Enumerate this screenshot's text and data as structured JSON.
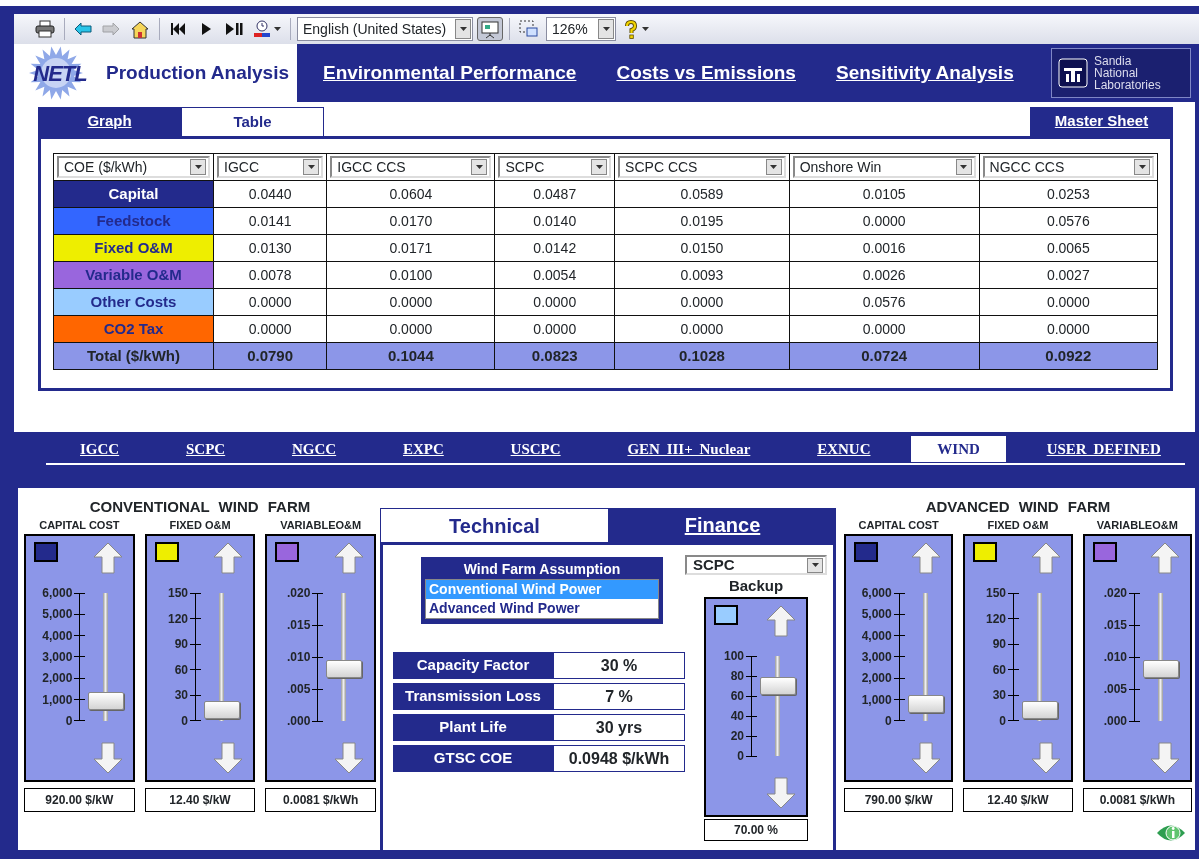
{
  "toolbar": {
    "buttons": [
      {
        "disabled": false,
        "pressed": false
      },
      {
        "disabled": false,
        "pressed": false
      },
      {
        "disabled": true,
        "pressed": false
      },
      {
        "disabled": false,
        "pressed": false
      },
      {
        "disabled": false,
        "pressed": false
      },
      {
        "disabled": false,
        "pressed": false
      },
      {
        "disabled": false,
        "pressed": false
      },
      {
        "disabled": false,
        "pressed": false
      },
      {
        "disabled": false,
        "pressed": true
      },
      {
        "disabled": false,
        "pressed": false
      },
      {
        "disabled": false,
        "pressed": false
      }
    ],
    "language": "English (United States)",
    "zoom": "126%"
  },
  "header": {
    "logo_text": "NETL",
    "nav": [
      {
        "label": "Production Analysis",
        "selected": true
      },
      {
        "label": "Environmental Performance",
        "selected": false
      },
      {
        "label": "Costs vs Emissions",
        "selected": false
      },
      {
        "label": "Sensitivity Analysis",
        "selected": false
      }
    ],
    "partner_logo": "Sandia National Laboratories"
  },
  "view_tabs": [
    {
      "label": "Graph",
      "selected": false
    },
    {
      "label": "Table",
      "selected": true
    }
  ],
  "master_sheet": "Master Sheet",
  "table": {
    "metric": "COE ($/kWh)",
    "columns": [
      "IGCC",
      "IGCC CCS",
      "SCPC",
      "SCPC CCS",
      "Onshore Win",
      "NGCC CCS"
    ],
    "rows": [
      {
        "label": "Capital",
        "color": "#232a8c",
        "values": [
          "0.0440",
          "0.0604",
          "0.0487",
          "0.0589",
          "0.0105",
          "0.0253"
        ]
      },
      {
        "label": "Feedstock",
        "color": "#3366ff",
        "values": [
          "0.0141",
          "0.0170",
          "0.0140",
          "0.0195",
          "0.0000",
          "0.0576"
        ]
      },
      {
        "label": "Fixed O&M",
        "color": "#eeee00",
        "values": [
          "0.0130",
          "0.0171",
          "0.0142",
          "0.0150",
          "0.0016",
          "0.0065"
        ]
      },
      {
        "label": "Variable O&M",
        "color": "#9966dd",
        "values": [
          "0.0078",
          "0.0100",
          "0.0054",
          "0.0093",
          "0.0026",
          "0.0027"
        ]
      },
      {
        "label": "Other Costs",
        "color": "#99ccff",
        "values": [
          "0.0000",
          "0.0000",
          "0.0000",
          "0.0000",
          "0.0576",
          "0.0000"
        ]
      },
      {
        "label": "CO2 Tax",
        "color": "#ff6600",
        "values": [
          "0.0000",
          "0.0000",
          "0.0000",
          "0.0000",
          "0.0000",
          "0.0000"
        ]
      }
    ],
    "total": {
      "label": "Total ($/kWh)",
      "values": [
        "0.0790",
        "0.1044",
        "0.0823",
        "0.1028",
        "0.0724",
        "0.0922"
      ]
    }
  },
  "tech_tabs": [
    {
      "label": "IGCC",
      "selected": false
    },
    {
      "label": "SCPC",
      "selected": false
    },
    {
      "label": "NGCC",
      "selected": false
    },
    {
      "label": "EXPC",
      "selected": false
    },
    {
      "label": "USCPC",
      "selected": false
    },
    {
      "label": "GEN III+ Nuclear",
      "selected": false
    },
    {
      "label": "EXNUC",
      "selected": false
    },
    {
      "label": "WIND",
      "selected": true
    },
    {
      "label": "USER DEFINED",
      "selected": false
    }
  ],
  "conventional": {
    "title": "CONVENTIONAL WIND FARM",
    "sliders": [
      {
        "label": "CAPITAL COST",
        "color": "#232a8c",
        "ticks": [
          "6,000",
          "5,000",
          "4,000",
          "3,000",
          "2,000",
          "1,000",
          "0"
        ],
        "level": 0.153,
        "reading": "920.00 $/kW"
      },
      {
        "label": "FIXED O&M",
        "color": "#eeee00",
        "ticks": [
          "150",
          "120",
          "90",
          "60",
          "30",
          "0"
        ],
        "level": 0.083,
        "reading": "12.40 $/kW"
      },
      {
        "label": "VARIABLEO&M",
        "color": "#9966dd",
        "ticks": [
          ".020",
          ".015",
          ".010",
          ".005",
          ".000"
        ],
        "level": 0.405,
        "reading": "0.0081 $/kWh"
      }
    ]
  },
  "center": {
    "tabs": [
      {
        "label": "Technical",
        "selected": true
      },
      {
        "label": "Finance",
        "selected": false
      }
    ],
    "assumption": {
      "title": "Wind Farm Assumption",
      "options": [
        {
          "label": "Conventional Wind Power",
          "selected": true
        },
        {
          "label": "Advanced Wind Power",
          "selected": false
        }
      ]
    },
    "params": [
      {
        "label": "Capacity Factor",
        "value": "30 %"
      },
      {
        "label": "Transmission Loss",
        "value": "7 %"
      },
      {
        "label": "Plant Life",
        "value": "30 yrs"
      },
      {
        "label": "GTSC COE",
        "value": "0.0948 $/kWh"
      }
    ],
    "backup": {
      "select": "SCPC",
      "label": "Backup",
      "slider": {
        "color": "#99ccff",
        "ticks": [
          "100",
          "80",
          "60",
          "40",
          "20",
          "0"
        ],
        "level": 0.7,
        "reading": "70.00 %"
      }
    }
  },
  "advanced": {
    "title": "ADVANCED WIND FARM",
    "sliders": [
      {
        "label": "CAPITAL COST",
        "color": "#232a8c",
        "ticks": [
          "6,000",
          "5,000",
          "4,000",
          "3,000",
          "2,000",
          "1,000",
          "0"
        ],
        "level": 0.132,
        "reading": "790.00 $/kW"
      },
      {
        "label": "FIXED O&M",
        "color": "#eeee00",
        "ticks": [
          "150",
          "120",
          "90",
          "60",
          "30",
          "0"
        ],
        "level": 0.083,
        "reading": "12.40 $/kW"
      },
      {
        "label": "VARIABLEO&M",
        "color": "#9966dd",
        "ticks": [
          ".020",
          ".015",
          ".010",
          ".005",
          ".000"
        ],
        "level": 0.405,
        "reading": "0.0081 $/kWh"
      }
    ]
  }
}
